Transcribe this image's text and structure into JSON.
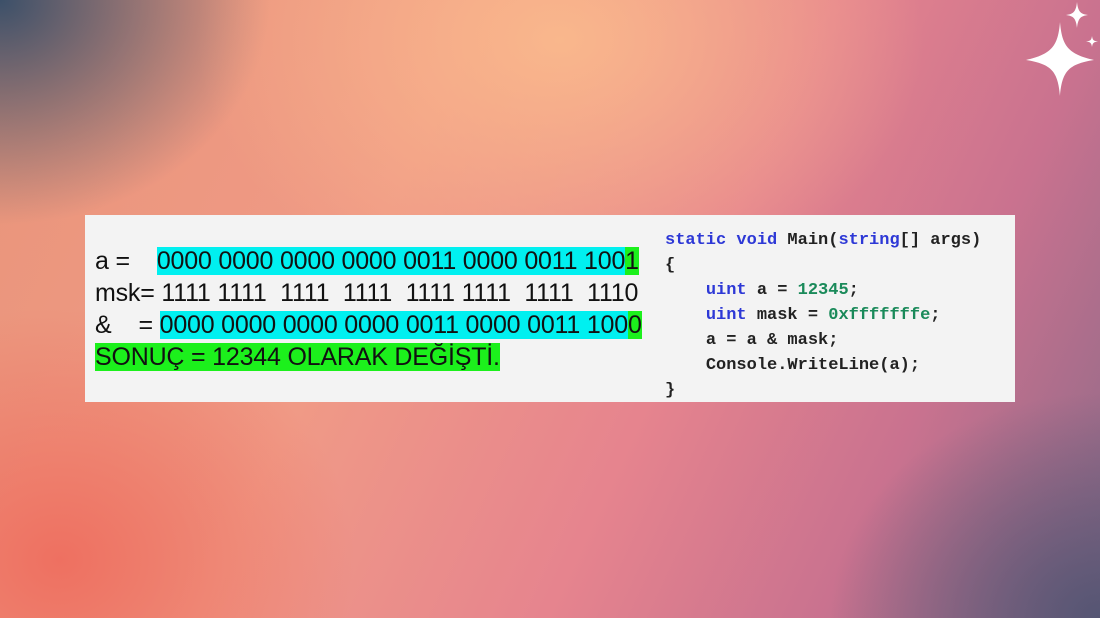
{
  "binary": {
    "line_a": {
      "label": "a =    ",
      "value_main": "0000 0000 0000 0000 0011 0000 0011 100",
      "value_last": "1"
    },
    "line_msk": {
      "label": "msk=",
      "value": " 1111 1111  1111  1111  1111 1111  1111  1110"
    },
    "line_and": {
      "label": "&    = ",
      "value_main": "0000 0000 0000 0000 0011 0000 0011 100",
      "value_last": "0"
    },
    "result": "SONUÇ = 12344 OLARAK DEĞİŞTİ."
  },
  "code": {
    "line1_kw1": "static",
    "line1_kw2": "void",
    "line1_name": " Main(",
    "line1_kw3": "string",
    "line1_rest": "[] args)",
    "line2": "{",
    "line3_kw": "uint",
    "line3_rest": " a = ",
    "line3_num": "12345",
    "line3_end": ";",
    "line4_kw": "uint",
    "line4_rest": " mask = ",
    "line4_num": "0xfffffffe",
    "line4_end": ";",
    "line5": "a = a & mask;",
    "line6": "Console.WriteLine(a);",
    "line7": "}"
  },
  "colors": {
    "highlight_cyan": "#00f0f0",
    "highlight_green": "#1cf01c",
    "keyword": "#2d38d6",
    "number": "#1a8a5a"
  },
  "icons": {
    "decoration": "sparkle-icon"
  }
}
